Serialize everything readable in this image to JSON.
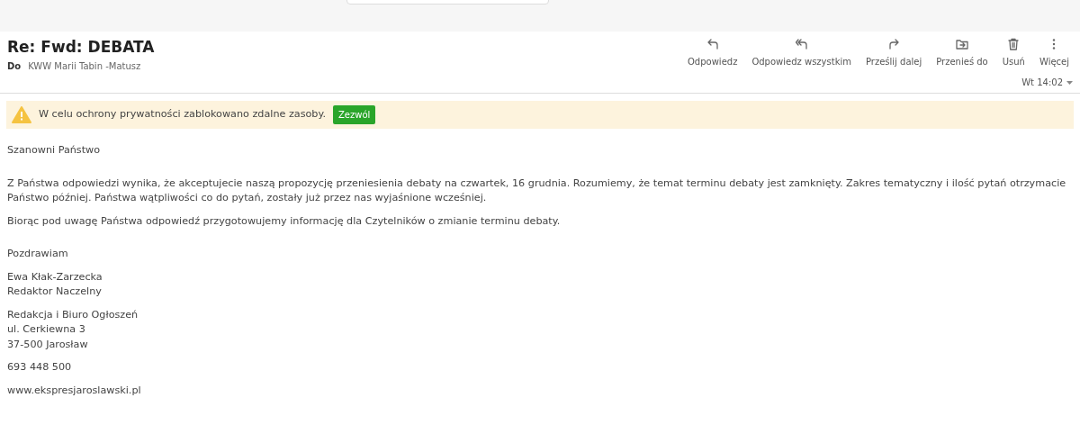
{
  "message": {
    "subject": "Re: Fwd: DEBATA",
    "to_label": "Do",
    "to": "KWW Marii Tabin -Matusz",
    "date": "Wt 14:02"
  },
  "actions": [
    {
      "kind": "reply",
      "label": "Odpowiedz"
    },
    {
      "kind": "reply_all",
      "label": "Odpowiedz wszystkim"
    },
    {
      "kind": "forward",
      "label": "Prześlij dalej"
    },
    {
      "kind": "move",
      "label": "Przenieś do"
    },
    {
      "kind": "delete",
      "label": "Usuń"
    },
    {
      "kind": "more",
      "label": "Więcej"
    }
  ],
  "notice": {
    "text": "W celu ochrony prywatności zablokowano zdalne zasoby.",
    "button": "Zezwól"
  },
  "body": [
    [
      "Szanowni Państwo"
    ],
    [
      "Z Państwa odpowiedzi wynika, że akceptujecie naszą propozycję przeniesienia debaty na czwartek, 16 grudnia. Rozumiemy, że temat terminu debaty jest zamknięty. Zakres tematyczny i ilość pytań otrzymacie Państwo później. Państwa wątpliwości co do pytań, zostały już przez nas wyjaśnione wcześniej."
    ],
    [
      "Biorąc pod uwagę Państwa odpowiedź przygotowujemy informację dla Czytelników o zmianie terminu debaty."
    ],
    [
      "Pozdrawiam"
    ],
    [
      "Ewa Kłak-Zarzecka",
      "Redaktor Naczelny"
    ],
    [
      "Redakcja i Biuro Ogłoszeń",
      "ul. Cerkiewna 3",
      "37-500 Jarosław"
    ],
    [
      "693 448 500"
    ],
    [
      "www.ekspresjaroslawski.pl"
    ]
  ]
}
